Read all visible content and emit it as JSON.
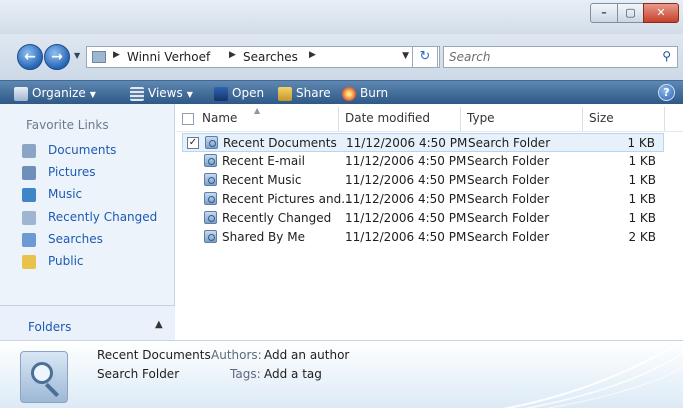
{
  "window": {
    "controls": {
      "minimize": "–",
      "maximize": "▢",
      "close": "✕"
    }
  },
  "address": {
    "breadcrumbs": [
      "Winni Verhoef",
      "Searches"
    ],
    "search_placeholder": "Search"
  },
  "toolbar": {
    "organize": "Organize",
    "views": "Views",
    "open": "Open",
    "share": "Share",
    "burn": "Burn",
    "help": "?"
  },
  "nav": {
    "heading": "Favorite Links",
    "links": [
      {
        "label": "Documents",
        "icon": "documents-icon",
        "color": "#8ba5c4"
      },
      {
        "label": "Pictures",
        "icon": "pictures-icon",
        "color": "#6f8fb8"
      },
      {
        "label": "Music",
        "icon": "music-icon",
        "color": "#3f86c9"
      },
      {
        "label": "Recently Changed",
        "icon": "recently-changed-icon",
        "color": "#9fb5d0"
      },
      {
        "label": "Searches",
        "icon": "searches-icon",
        "color": "#6c9bd4"
      },
      {
        "label": "Public",
        "icon": "public-icon",
        "color": "#e8c24a"
      }
    ],
    "folders_label": "Folders"
  },
  "columns": [
    "Name",
    "Date modified",
    "Type",
    "Size"
  ],
  "files": [
    {
      "name": "Recent Documents",
      "date": "11/12/2006 4:50 PM",
      "type": "Search Folder",
      "size": "1 KB",
      "selected": true
    },
    {
      "name": "Recent E-mail",
      "date": "11/12/2006 4:50 PM",
      "type": "Search Folder",
      "size": "1 KB"
    },
    {
      "name": "Recent Music",
      "date": "11/12/2006 4:50 PM",
      "type": "Search Folder",
      "size": "1 KB"
    },
    {
      "name": "Recent Pictures and...",
      "date": "11/12/2006 4:50 PM",
      "type": "Search Folder",
      "size": "1 KB"
    },
    {
      "name": "Recently Changed",
      "date": "11/12/2006 4:50 PM",
      "type": "Search Folder",
      "size": "1 KB"
    },
    {
      "name": "Shared By Me",
      "date": "11/12/2006 4:50 PM",
      "type": "Search Folder",
      "size": "2 KB"
    }
  ],
  "details": {
    "name": "Recent Documents",
    "type": "Search Folder",
    "authors_label": "Authors:",
    "authors_value": "Add an author",
    "tags_label": "Tags:",
    "tags_value": "Add a tag"
  }
}
